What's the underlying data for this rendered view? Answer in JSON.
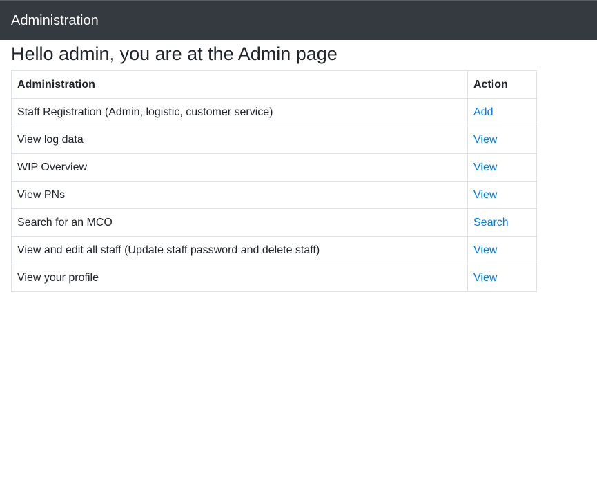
{
  "navbar": {
    "brand": "Administration"
  },
  "page": {
    "heading": "Hello admin, you are at the Admin page"
  },
  "table": {
    "headers": {
      "administration": "Administration",
      "action": "Action"
    },
    "rows": [
      {
        "label": "Staff Registration (Admin, logistic, customer service)",
        "action": "Add"
      },
      {
        "label": "View log data",
        "action": "View"
      },
      {
        "label": "WIP Overview",
        "action": "View"
      },
      {
        "label": "View PNs",
        "action": "View"
      },
      {
        "label": "Search for an MCO",
        "action": "Search"
      },
      {
        "label": "View and edit all staff (Update staff password and delete staff)",
        "action": "View"
      },
      {
        "label": "View your profile",
        "action": "View"
      }
    ]
  },
  "colors": {
    "navbar_bg": "#343a40",
    "link": "#007bff",
    "border": "#dee2e6"
  }
}
